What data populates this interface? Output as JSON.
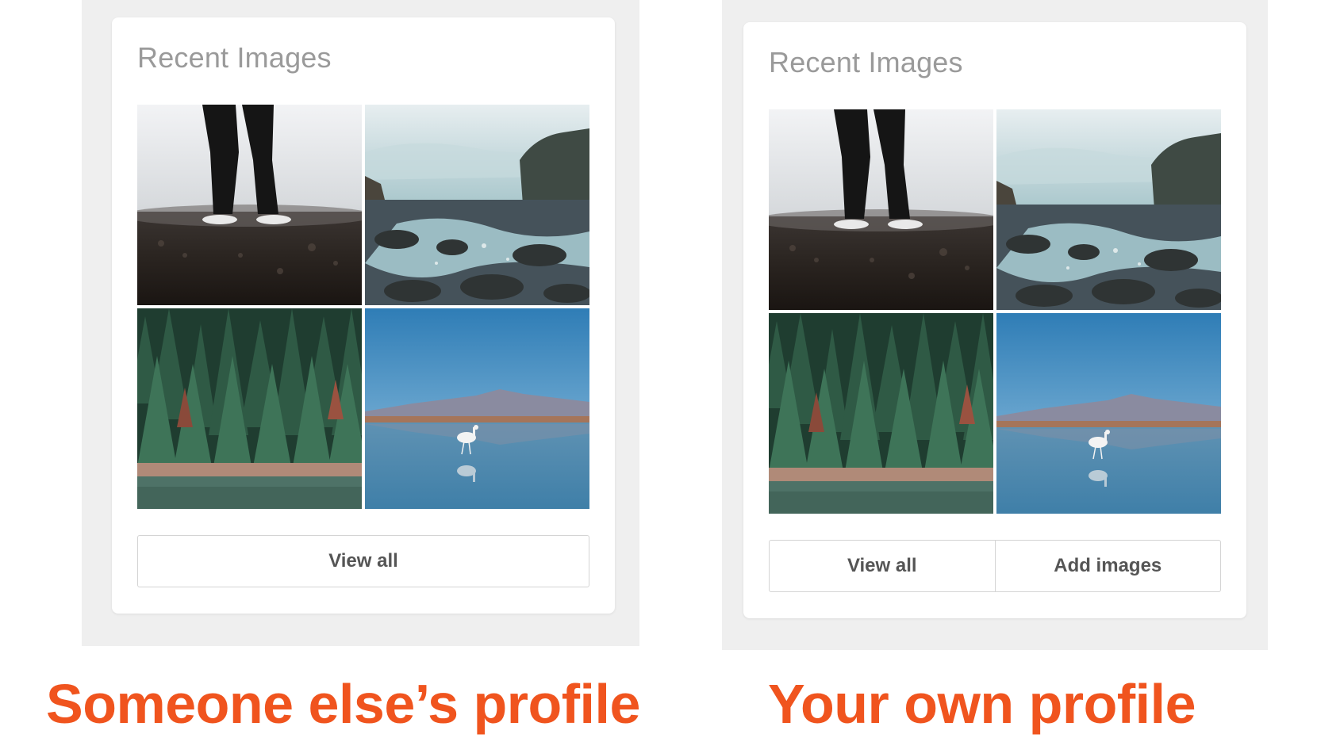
{
  "left_example": {
    "card_title": "Recent Images",
    "buttons": {
      "view_all": "View all"
    },
    "caption": "Someone else’s profile"
  },
  "right_example": {
    "card_title": "Recent Images",
    "buttons": {
      "view_all": "View all",
      "add_images": "Add images"
    },
    "caption": "Your own profile"
  },
  "photos": [
    "standing-person-photo",
    "rocky-coast-photo",
    "pine-forest-photo",
    "flamingo-lake-photo"
  ],
  "colors": {
    "caption": "#f0541e",
    "panel_bg": "#efefef",
    "card_bg": "#ffffff",
    "title": "#9a9a9a"
  }
}
